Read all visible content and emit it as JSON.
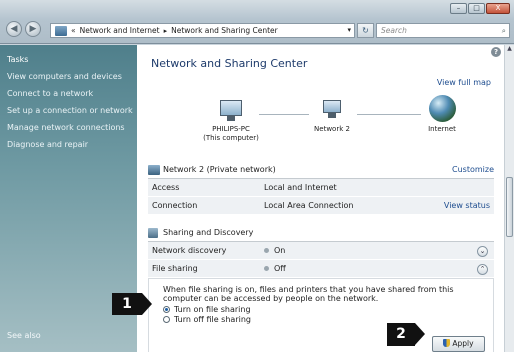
{
  "window": {
    "minimize_label": "–",
    "maximize_label": "□",
    "close_label": "X"
  },
  "toolbar": {
    "back_icon": "back-arrow",
    "forward_icon": "forward-arrow",
    "breadcrumb": {
      "prefix": "«",
      "crumb1": "Network and Internet",
      "sep": "▸",
      "crumb2": "Network and Sharing Center",
      "dropdown": "▾"
    },
    "refresh_glyph": "↻",
    "search_placeholder": "Search",
    "search_glyph": "⌕"
  },
  "sidebar": {
    "heading": "Tasks",
    "items": [
      {
        "label": "View computers and devices"
      },
      {
        "label": "Connect to a network"
      },
      {
        "label": "Set up a connection or network"
      },
      {
        "label": "Manage network connections"
      },
      {
        "label": "Diagnose and repair"
      }
    ],
    "see_also": "See also"
  },
  "main": {
    "help_glyph": "?",
    "title": "Network and Sharing Center",
    "view_full_map": "View full map",
    "nodes": {
      "pc_name": "PHILIPS-PC",
      "pc_sub": "(This computer)",
      "network": "Network 2",
      "internet": "Internet"
    },
    "network": {
      "name": "Network 2 (Private network)",
      "customize": "Customize",
      "rows": [
        {
          "key": "Access",
          "value": "Local and Internet",
          "link": ""
        },
        {
          "key": "Connection",
          "value": "Local Area Connection",
          "link": "View status"
        }
      ]
    },
    "sharing": {
      "heading": "Sharing and Discovery",
      "rows": [
        {
          "key": "Network discovery",
          "value": "On",
          "chevron": "⌄"
        },
        {
          "key": "File sharing",
          "value": "Off",
          "chevron": "⌃"
        }
      ],
      "description": "When file sharing is on, files and printers that you have shared from this computer can be accessed by people on the network.",
      "option_on": "Turn on file sharing",
      "option_off": "Turn off file sharing",
      "apply": "Apply"
    }
  },
  "callouts": {
    "one": "1",
    "two": "2"
  }
}
